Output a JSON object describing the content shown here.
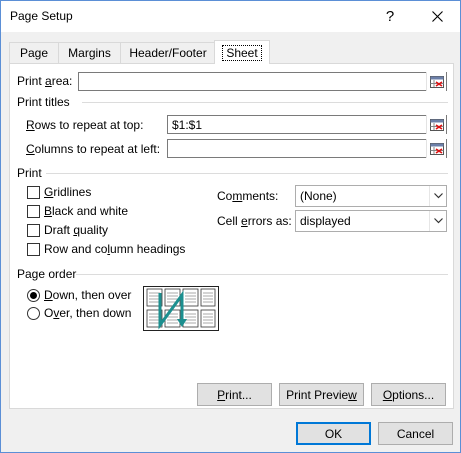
{
  "window": {
    "title": "Page Setup",
    "help_label": "?",
    "close_label": "✕"
  },
  "tabs": [
    {
      "label": "Page"
    },
    {
      "label": "Margins"
    },
    {
      "label": "Header/Footer"
    },
    {
      "label": "Sheet",
      "active": true
    }
  ],
  "print_area": {
    "label_pre": "Print ",
    "label_key": "a",
    "label_post": "rea:",
    "value": ""
  },
  "print_titles": {
    "heading": "Print titles",
    "rows": {
      "label_key": "R",
      "label_post": "ows to repeat at top:",
      "value": "$1:$1"
    },
    "columns": {
      "label_key": "C",
      "label_post": "olumns to repeat at left:",
      "value": ""
    }
  },
  "print": {
    "heading": "Print",
    "options": [
      {
        "label_key": "G",
        "label_post": "ridlines",
        "checked": false
      },
      {
        "label_key": "B",
        "label_post": "lack and white",
        "checked": false
      },
      {
        "label_pre": "Draft ",
        "label_key": "q",
        "label_post": "uality",
        "checked": false
      },
      {
        "label_pre": "Row and co",
        "label_key": "l",
        "label_post": "umn headings",
        "checked": false
      }
    ],
    "comments": {
      "label_pre": "Co",
      "label_key": "m",
      "label_post": "ments:",
      "value": "(None)"
    },
    "cell_errors": {
      "label_pre": "Cell ",
      "label_key": "e",
      "label_post": "rrors as:",
      "value": "displayed"
    }
  },
  "page_order": {
    "heading": "Page order",
    "down_then_over": {
      "label_key": "D",
      "label_post": "own, then over",
      "selected": true
    },
    "over_then_down": {
      "label_pre": "O",
      "label_key": "v",
      "label_post": "er, then down",
      "selected": false
    }
  },
  "buttons": {
    "print": {
      "label_key": "P",
      "label_post": "rint..."
    },
    "print_preview": {
      "label_pre": "Print Previe",
      "label_key": "w",
      "label_post": ""
    },
    "options": {
      "label_key": "O",
      "label_post": "ptions..."
    },
    "ok": "OK",
    "cancel": "Cancel"
  },
  "colors": {
    "accent": "#0078d7",
    "order_arrow": "#1c8f8f"
  },
  "icons": {
    "collapse_dialog": "range-select-icon",
    "dropdown": "chevron-down-icon"
  }
}
